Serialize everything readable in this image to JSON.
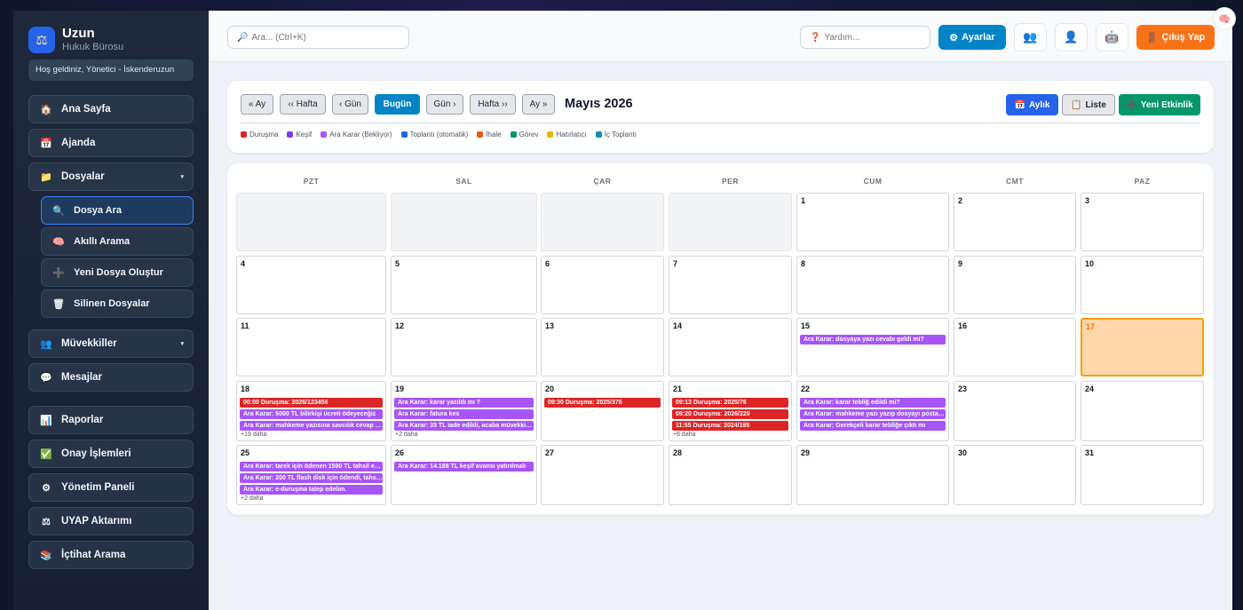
{
  "brand": {
    "logo_icon": "scales-icon",
    "name": "Uzun",
    "subtitle": "Hukuk Bürosu"
  },
  "welcome": "Hoş geldiniz, Yönetici - İskenderuzun",
  "sidebar": {
    "items": [
      {
        "label": "Ana Sayfa",
        "icon": "🏠"
      },
      {
        "label": "Ajanda",
        "icon": "📅"
      },
      {
        "label": "Dosyalar",
        "icon": "📁",
        "caret": "▾"
      }
    ],
    "sub_items": [
      {
        "label": "Dosya Ara",
        "icon": "🔍"
      },
      {
        "label": "Akıllı Arama",
        "icon": "🧠"
      },
      {
        "label": "Yeni Dosya Oluştur",
        "icon": "➕"
      },
      {
        "label": "Silinen Dosyalar",
        "icon": "🗑"
      }
    ],
    "items2": [
      {
        "label": "Müvekkiller",
        "icon": "👥",
        "caret": "▾"
      },
      {
        "label": "Mesajlar",
        "icon": "💬"
      }
    ],
    "items3": [
      {
        "label": "Raporlar",
        "icon": "📊"
      },
      {
        "label": "Onay İşlemleri",
        "icon": "✅"
      },
      {
        "label": "Yönetim Paneli",
        "icon": "⚙"
      },
      {
        "label": "UYAP Aktarımı",
        "icon": "⚖"
      },
      {
        "label": "İçtihat Arama",
        "icon": "📚"
      }
    ]
  },
  "topbar": {
    "search_placeholder": "Ara... (Ctrl+K)",
    "search_icon": "🔎",
    "help_placeholder": "Yardım...",
    "help_icon": "❓",
    "settings_label": "Ayarlar",
    "settings_icon": "⚙",
    "icon_buttons": [
      "👥",
      "👤",
      "🤖"
    ],
    "logout_label": "Çıkış Yap",
    "logout_icon": "🚪",
    "floating_icon": "🧠"
  },
  "toolbar": {
    "buttons": [
      "« Ay",
      "‹‹ Hafta",
      "‹ Gün",
      "Bugün",
      "Gün ›",
      "Hafta ››",
      "Ay »"
    ],
    "month_title": "Mayıs 2026",
    "view_monthly": "Aylık",
    "view_monthly_icon": "📅",
    "view_list": "Liste",
    "view_list_icon": "📋",
    "new_event": "Yeni Etkinlik",
    "new_event_icon": "➕",
    "colors": {
      "today": "#0284c7",
      "monthly": "#2563eb",
      "new": "#059669"
    }
  },
  "legend": [
    {
      "label": "Duruşma",
      "color": "#dc2626"
    },
    {
      "label": "Keşif",
      "color": "#7c3aed"
    },
    {
      "label": "Ara Karar (Bekliyor)",
      "color": "#a855f7"
    },
    {
      "label": "Toplantı (otomatik)",
      "color": "#2563eb"
    },
    {
      "label": "İhale",
      "color": "#ea580c"
    },
    {
      "label": "Görev",
      "color": "#059669"
    },
    {
      "label": "Hatırlatıcı",
      "color": "#eab308"
    },
    {
      "label": "İç Toplantı",
      "color": "#0891b2"
    }
  ],
  "calendar": {
    "weekdays": [
      "PZT",
      "SAL",
      "ÇAR",
      "PER",
      "CUM",
      "CMT",
      "PAZ"
    ],
    "weeks": [
      [
        null,
        null,
        null,
        null,
        {
          "day": "1"
        },
        {
          "day": "2"
        },
        {
          "day": "3"
        }
      ],
      [
        {
          "day": "4"
        },
        {
          "day": "5"
        },
        {
          "day": "6"
        },
        {
          "day": "7"
        },
        {
          "day": "8"
        },
        {
          "day": "9"
        },
        {
          "day": "10"
        }
      ],
      [
        {
          "day": "11"
        },
        {
          "day": "12"
        },
        {
          "day": "13"
        },
        {
          "day": "14"
        },
        {
          "day": "15",
          "events": [
            {
              "type": "karar",
              "text": "Ara Karar: dosyaya yazı cevabı geldi mi?"
            }
          ]
        },
        {
          "day": "16"
        },
        {
          "day": "17",
          "today": true
        }
      ],
      [
        {
          "day": "18",
          "events": [
            {
              "type": "durusma",
              "text": "00:00 Duruşma: 2026/123456"
            },
            {
              "type": "karar",
              "text": "Ara Karar: 5000 TL bilirkişi ücreti ödeyeceğiz"
            },
            {
              "type": "karar",
              "text": "Ara Karar: mahkeme yazısına savcılık cevap verdi mi"
            }
          ],
          "more": "+19 daha"
        },
        {
          "day": "19",
          "events": [
            {
              "type": "karar",
              "text": "Ara Karar: karar yazıldı mı ?"
            },
            {
              "type": "karar",
              "text": "Ara Karar: fatura kes"
            },
            {
              "type": "karar",
              "text": "Ara Karar: 35 TL iade edildi, acaba müvekkile bildirildi mi"
            }
          ],
          "more": "+2 daha"
        },
        {
          "day": "20",
          "events": [
            {
              "type": "durusma",
              "text": "09:30 Duruşma: 2025/376"
            }
          ]
        },
        {
          "day": "21",
          "events": [
            {
              "type": "durusma",
              "text": "09:13 Duruşma: 2025/76"
            },
            {
              "type": "durusma",
              "text": "09:20 Duruşma: 2026/220"
            },
            {
              "type": "durusma",
              "text": "11:55 Duruşma: 2024/195"
            }
          ],
          "more": "+6 daha"
        },
        {
          "day": "22",
          "events": [
            {
              "type": "karar",
              "text": "Ara Karar: karar tebliğ edildi mi?"
            },
            {
              "type": "karar",
              "text": "Ara Karar: mahkeme yazı yazıp dosyayı postaya verdi mi"
            },
            {
              "type": "karar",
              "text": "Ara Karar: Gerekçeli karar tebliğe çıktı mı"
            }
          ]
        },
        {
          "day": "23"
        },
        {
          "day": "24"
        }
      ],
      [
        {
          "day": "25",
          "events": [
            {
              "type": "karar",
              "text": "Ara Karar: tarek için ödenen 1590 TL tahsil edildi mi"
            },
            {
              "type": "karar",
              "text": "Ara Karar: 200 TL flash disk için ödendi, tahsil et"
            },
            {
              "type": "karar",
              "text": "Ara Karar: e-duruşma talep edelim."
            }
          ],
          "more": "+2 daha"
        },
        {
          "day": "26",
          "events": [
            {
              "type": "karar",
              "text": "Ara Karar: 14.188 TL keşif avansı yatırılmalı"
            }
          ]
        },
        {
          "day": "27"
        },
        {
          "day": "28"
        },
        {
          "day": "29"
        },
        {
          "day": "30"
        },
        {
          "day": "31"
        }
      ]
    ]
  }
}
